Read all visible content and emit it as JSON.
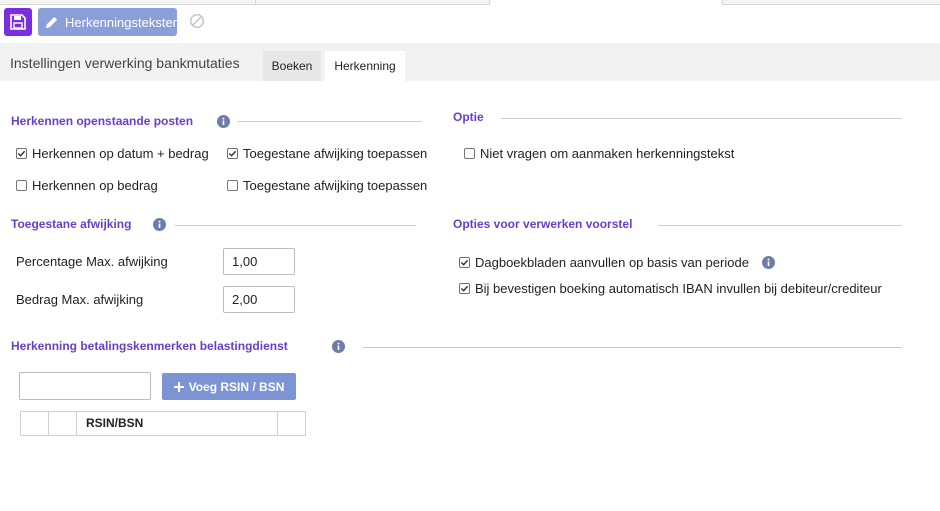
{
  "toolbar": {
    "herkenningsteksten_label": "Herkenningsteksten"
  },
  "header": {
    "title": "Instellingen verwerking bankmutaties",
    "tabs": [
      {
        "label": "Boeken"
      },
      {
        "label": "Herkenning"
      }
    ]
  },
  "sections": {
    "openstaande": {
      "title": "Herkennen openstaande posten",
      "options": [
        {
          "label": "Herkennen op datum + bedrag",
          "checked": true
        },
        {
          "label": "Toegestane afwijking toepassen",
          "checked": true
        },
        {
          "label": "Herkennen op bedrag",
          "checked": false
        },
        {
          "label": "Toegestane afwijking toepassen",
          "checked": false
        }
      ]
    },
    "optie": {
      "title": "Optie",
      "options": [
        {
          "label": "Niet vragen om aanmaken herkenningstekst",
          "checked": false
        }
      ]
    },
    "afwijking": {
      "title": "Toegestane afwijking",
      "percentage_label": "Percentage Max. afwijking",
      "percentage_value": "1,00",
      "bedrag_label": "Bedrag Max. afwijking",
      "bedrag_value": "2,00"
    },
    "voorstel": {
      "title": "Opties voor verwerken voorstel",
      "options": [
        {
          "label": "Dagboekbladen aanvullen op basis van periode",
          "checked": true
        },
        {
          "label": "Bij bevestigen boeking automatisch IBAN invullen bij debiteur/crediteur",
          "checked": true
        }
      ]
    },
    "belasting": {
      "title": "Herkenning betalingskenmerken belastingdienst",
      "add_button_label": "Voeg RSIN / BSN",
      "rsin_input_value": "",
      "table_columns": [
        "RSIN/BSN"
      ]
    }
  },
  "colors": {
    "accent_purple": "#7b2de0",
    "section_title": "#6a3fc8",
    "button_blue": "#8a9fd8"
  }
}
